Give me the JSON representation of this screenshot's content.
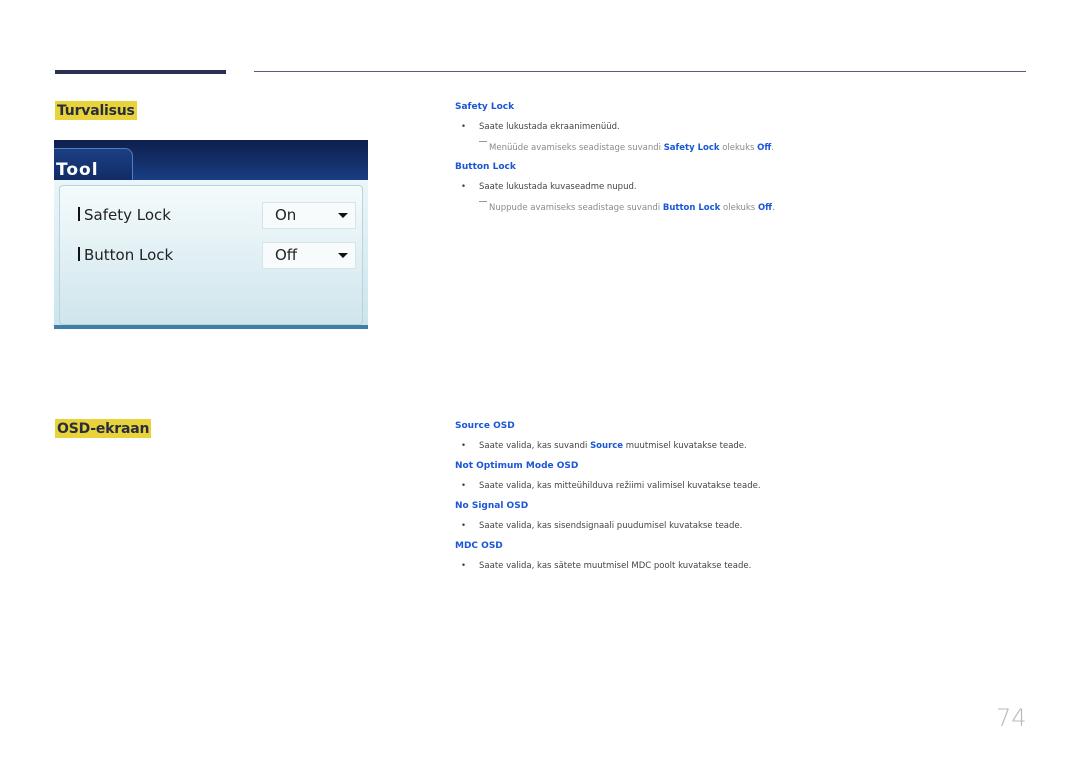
{
  "sections": {
    "security": {
      "title": "Turvalisus",
      "screenshot": {
        "tab_label": "Tool",
        "rows": [
          {
            "label": "Safety Lock",
            "value": "On"
          },
          {
            "label": "Button Lock",
            "value": "Off"
          }
        ]
      },
      "items": [
        {
          "heading": "Safety Lock",
          "bullet": "Saate lukustada ekraanimenüüd.",
          "note": {
            "prefix": "Menüüde avamiseks seadistage suvandi ",
            "kw1": "Safety Lock",
            "middle": " olekuks ",
            "kw2": "Off",
            "suffix": "."
          }
        },
        {
          "heading": "Button Lock",
          "bullet": "Saate lukustada kuvaseadme nupud.",
          "note": {
            "prefix": "Nuppude avamiseks seadistage suvandi ",
            "kw1": "Button Lock",
            "middle": " olekuks ",
            "kw2": "Off",
            "suffix": "."
          }
        }
      ]
    },
    "osd": {
      "title": "OSD-ekraan",
      "items": [
        {
          "heading": "Source OSD",
          "bullet_prefix": "Saate valida, kas suvandi ",
          "bullet_kw": "Source",
          "bullet_suffix": " muutmisel kuvatakse teade."
        },
        {
          "heading": "Not Optimum Mode OSD",
          "bullet": "Saate valida, kas mitteühilduva režiimi valimisel kuvatakse teade."
        },
        {
          "heading": "No Signal OSD",
          "bullet": "Saate valida, kas sisendsignaali puudumisel kuvatakse teade."
        },
        {
          "heading": "MDC OSD",
          "bullet": "Saate valida, kas sätete muutmisel MDC poolt kuvatakse teade."
        }
      ]
    }
  },
  "bullet_glyph": "•",
  "page_number": "74",
  "colors": {
    "highlight": "#e8d43a",
    "keyword_blue": "#1a56d6",
    "rule": "#2b2f4f"
  }
}
